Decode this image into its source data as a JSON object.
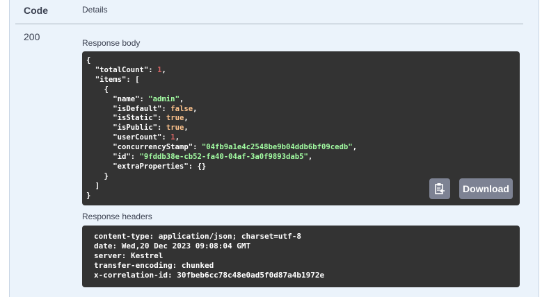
{
  "table": {
    "code_header": "Code",
    "details_header": "Details"
  },
  "response": {
    "code": "200",
    "body_label": "Response body",
    "body_lines": [
      [
        {
          "t": "{",
          "c": "k"
        }
      ],
      [
        {
          "t": "  \"totalCount\": ",
          "c": "k"
        },
        {
          "t": "1",
          "c": "n"
        },
        {
          "t": ",",
          "c": "k"
        }
      ],
      [
        {
          "t": "  \"items\": [",
          "c": "k"
        }
      ],
      [
        {
          "t": "    {",
          "c": "k"
        }
      ],
      [
        {
          "t": "      \"name\": ",
          "c": "k"
        },
        {
          "t": "\"admin\"",
          "c": "s"
        },
        {
          "t": ",",
          "c": "k"
        }
      ],
      [
        {
          "t": "      \"isDefault\": ",
          "c": "k"
        },
        {
          "t": "false",
          "c": "b"
        },
        {
          "t": ",",
          "c": "k"
        }
      ],
      [
        {
          "t": "      \"isStatic\": ",
          "c": "k"
        },
        {
          "t": "true",
          "c": "b"
        },
        {
          "t": ",",
          "c": "k"
        }
      ],
      [
        {
          "t": "      \"isPublic\": ",
          "c": "k"
        },
        {
          "t": "true",
          "c": "b"
        },
        {
          "t": ",",
          "c": "k"
        }
      ],
      [
        {
          "t": "      \"userCount\": ",
          "c": "k"
        },
        {
          "t": "1",
          "c": "n"
        },
        {
          "t": ",",
          "c": "k"
        }
      ],
      [
        {
          "t": "      \"concurrencyStamp\": ",
          "c": "k"
        },
        {
          "t": "\"04fb9a1e4c2548be9b04ddb6bf09cedb\"",
          "c": "s"
        },
        {
          "t": ",",
          "c": "k"
        }
      ],
      [
        {
          "t": "      \"id\": ",
          "c": "k"
        },
        {
          "t": "\"9fddb38e-cb52-fa40-04af-3a0f9893dab5\"",
          "c": "s"
        },
        {
          "t": ",",
          "c": "k"
        }
      ],
      [
        {
          "t": "      \"extraProperties\": {}",
          "c": "k"
        }
      ],
      [
        {
          "t": "    }",
          "c": "k"
        }
      ],
      [
        {
          "t": "  ]",
          "c": "k"
        }
      ],
      [
        {
          "t": "}",
          "c": "k"
        }
      ]
    ],
    "download_label": "Download",
    "copy_icon": "clipboard-copy-icon",
    "headers_label": "Response headers",
    "headers_lines": [
      "content-type: application/json; charset=utf-8",
      "date: Wed,20 Dec 2023 09:08:04 GMT",
      "server: Kestrel",
      "transfer-encoding: chunked",
      "x-correlation-id: 30fbeb6cc78c48e0ad5f0d87a4b1972e"
    ]
  },
  "colors": {
    "key": "#ffffff",
    "number": "#d36363",
    "string": "#a2fca2",
    "boolean": "#fcc28c",
    "code_bg": "#333333",
    "button": "#7d8293"
  }
}
